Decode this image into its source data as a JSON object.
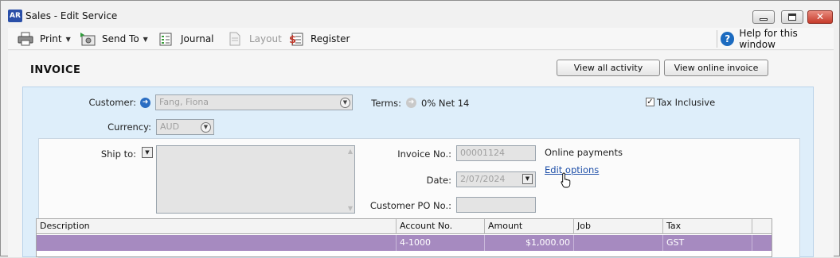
{
  "window": {
    "app_badge": "AR",
    "title": "Sales - Edit Service"
  },
  "toolbar": {
    "print": "Print",
    "send_to": "Send To",
    "journal": "Journal",
    "layout": "Layout",
    "register": "Register",
    "help": "Help for this window"
  },
  "header": {
    "heading": "INVOICE",
    "view_activity": "View all activity",
    "view_online": "View online invoice"
  },
  "form": {
    "customer_label": "Customer:",
    "customer_value": "Fang, Fiona",
    "terms_label": "Terms:",
    "terms_value": "0% Net 14",
    "tax_inclusive_label": "Tax Inclusive",
    "tax_inclusive_checked": true,
    "currency_label": "Currency:",
    "currency_value": "AUD",
    "ship_to_label": "Ship to:",
    "invoice_no_label": "Invoice No.:",
    "invoice_no_value": "00001124",
    "date_label": "Date:",
    "date_value": "2/07/2024",
    "customer_po_label": "Customer PO No.:",
    "customer_po_value": "",
    "online_payments_label": "Online payments",
    "edit_options_link": "Edit options"
  },
  "table": {
    "columns": [
      "Description",
      "Account No.",
      "Amount",
      "Job",
      "Tax"
    ],
    "rows": [
      {
        "description": "",
        "account_no": "4-1000",
        "amount": "$1,000.00",
        "job": "",
        "tax": "GST"
      }
    ],
    "selected_row_color": "#a68ac0"
  },
  "colors": {
    "accent_blue": "#1c6bc0",
    "panel_blue": "#deeefa",
    "link": "#1e4fa8"
  }
}
